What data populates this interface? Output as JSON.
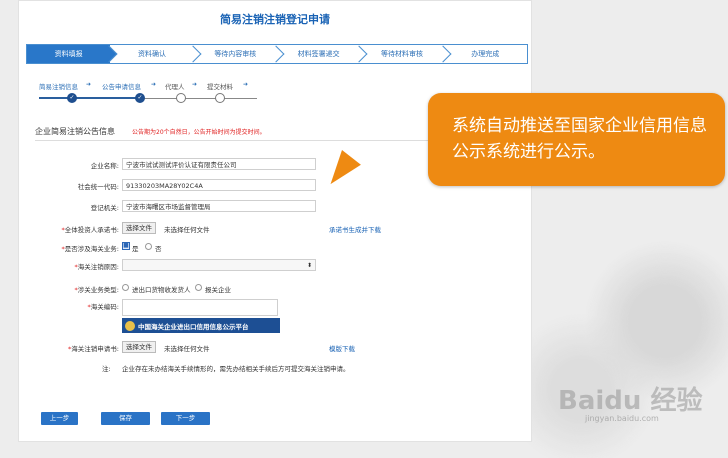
{
  "page_title": "简易注销注销登记申请",
  "steps": [
    {
      "label": "资料填报",
      "active": true
    },
    {
      "label": "资料确认",
      "active": false
    },
    {
      "label": "等待内容审核",
      "active": false
    },
    {
      "label": "材料签署递交",
      "active": false
    },
    {
      "label": "等待材料审核",
      "active": false
    },
    {
      "label": "办理完成",
      "active": false
    }
  ],
  "sub_steps": {
    "s1": "简易注销信息",
    "s2": "公告申请信息",
    "s3": "代理人",
    "s4": "提交材料",
    "arrow": "➜"
  },
  "section": {
    "title": "企业简易注销公告信息",
    "note": "公告期为20个自然日，公告开始时间为提交时间。"
  },
  "form": {
    "company_name": {
      "label": "企业名称:",
      "value": "宁波市试试测试评价认证有限责任公司"
    },
    "credit_code": {
      "label": "社会统一代码:",
      "value": "91330203MA28Y02C4A"
    },
    "registry": {
      "label": "登记机关:",
      "value": "宁波市海曙区市场监督管理局"
    },
    "investor_letter": {
      "label": "全体投资人承诺书:",
      "button": "选择文件",
      "file_status": "未选择任何文件",
      "link": "承诺书生成并下载"
    },
    "customs_involved": {
      "label": "是否涉及海关业务:",
      "yes": "是",
      "no": "否"
    },
    "customs_reason": {
      "label": "海关注销原因:",
      "value": ""
    },
    "customs_type": {
      "label": "涉关业务类型:",
      "opt1": "进出口货物收发货人",
      "opt2": "报关企业"
    },
    "customs_code": {
      "label": "海关编码:",
      "value": ""
    },
    "customs_form": {
      "label": "海关注销申请书:",
      "button": "选择文件",
      "file_status": "未选择任何文件",
      "link": "模版下载"
    },
    "note": {
      "label": "注:",
      "text": "企业存在未办结海关手续情形的，需先办结相关手续后方可提交海关注销申请。"
    }
  },
  "banner": {
    "text": "中国海关企业进出口信用信息公示平台"
  },
  "buttons": {
    "prev": "上一步",
    "save": "保存",
    "next": "下一步"
  },
  "callout": {
    "text": "系统自动推送至国家企业信用信息公示系统进行公示。"
  },
  "watermark": {
    "main": "Baidu 经验",
    "sub": "jingyan.baidu.com"
  },
  "colors": {
    "accent": "#2977c9",
    "callout": "#ee8a12",
    "required": "#e02020"
  }
}
